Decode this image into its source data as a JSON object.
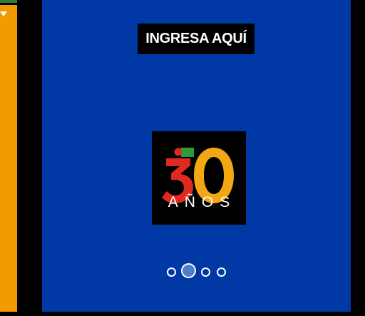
{
  "left_panel": {
    "icon": "caret-down-icon",
    "color": "#f29a00",
    "accent": "#2e7d32"
  },
  "slide": {
    "background": "#0039a6",
    "cta_label": "INGRESA AQUÍ",
    "logo": {
      "number": "30",
      "subtitle": "AÑOS",
      "colors": {
        "red": "#e02a20",
        "orange": "#f3a712",
        "green": "#2e9a3e"
      }
    }
  },
  "carousel": {
    "total_slides": 4,
    "active_slide": 2
  }
}
